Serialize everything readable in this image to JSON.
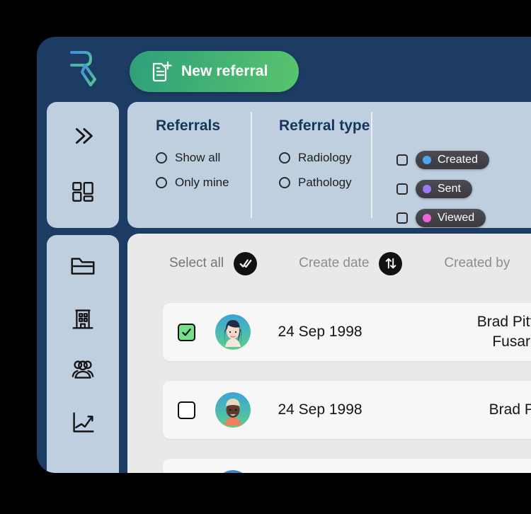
{
  "brand": {
    "logo_icon": "r-pen-logo-icon",
    "gradient_from": "#3f8fe0",
    "gradient_to": "#55c98e"
  },
  "topbar": {
    "background": "#1d3c63",
    "new_referral_label": "New referral",
    "new_referral_icon": "document-plus-icon",
    "button_gradient_from": "#2f9f7c",
    "button_gradient_to": "#59c46e"
  },
  "rail": {
    "background": "#bfcfe0",
    "top_items": [
      {
        "icon": "double-chevron-right-icon",
        "name": "expand-sidebar"
      },
      {
        "icon": "dashboard-grid-icon",
        "name": "dashboard"
      }
    ],
    "bottom_items": [
      {
        "icon": "folder-icon",
        "name": "folders"
      },
      {
        "icon": "building-icon",
        "name": "organisations"
      },
      {
        "icon": "people-group-icon",
        "name": "contacts"
      },
      {
        "icon": "line-chart-icon",
        "name": "analytics"
      }
    ]
  },
  "filters": {
    "groups": [
      {
        "title": "Referrals",
        "options": [
          {
            "label": "Show all",
            "control": "radio",
            "checked": false
          },
          {
            "label": "Only mine",
            "control": "radio",
            "checked": false
          }
        ]
      },
      {
        "title": "Referral type",
        "options": [
          {
            "label": "Radiology",
            "control": "radio",
            "checked": false
          },
          {
            "label": "Pathology",
            "control": "radio",
            "checked": false
          }
        ]
      }
    ],
    "status": {
      "options": [
        {
          "label": "Created",
          "dot_color": "#4aa8f0",
          "checked": false
        },
        {
          "label": "Sent",
          "dot_color": "#9b7bf5",
          "checked": false
        },
        {
          "label": "Viewed",
          "dot_color": "#ef63d6",
          "checked": false
        }
      ],
      "chip_background": "#40404a"
    }
  },
  "table": {
    "background": "#e9e9e9",
    "header": {
      "select_all_label": "Select all",
      "select_all_icon": "double-check-icon",
      "create_date_label": "Create date",
      "create_date_icon": "sort-updown-icon",
      "created_by_label": "Created by"
    },
    "rows": [
      {
        "checked": true,
        "avatar": "avatar-woman-dark-hair",
        "date": "24 Sep 1998",
        "created_by": "Brad Pitt, G\nFusaro"
      },
      {
        "checked": false,
        "avatar": "avatar-man-light-hair",
        "date": "24 Sep 1998",
        "created_by": "Brad Pit"
      },
      {
        "checked": false,
        "avatar": "avatar-partial",
        "date": "",
        "created_by": ""
      }
    ]
  }
}
